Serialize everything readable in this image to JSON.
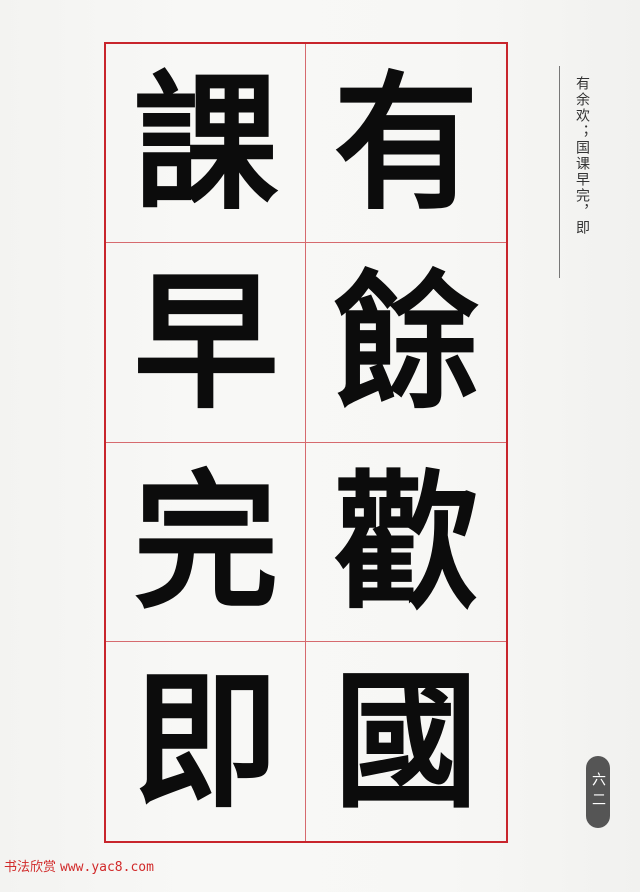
{
  "grid": {
    "cells": [
      "課",
      "有",
      "早",
      "餘",
      "完",
      "歡",
      "即",
      "國"
    ]
  },
  "caption": "有余欢；国课早完，即",
  "page_number": "六二",
  "watermark": {
    "site_name": "书法欣赏",
    "url": "www.yac8.com"
  },
  "colors": {
    "grid_border": "#c8252c",
    "ink": "#0c0c0c",
    "watermark": "#d12a2a",
    "page_badge": "#555555"
  }
}
